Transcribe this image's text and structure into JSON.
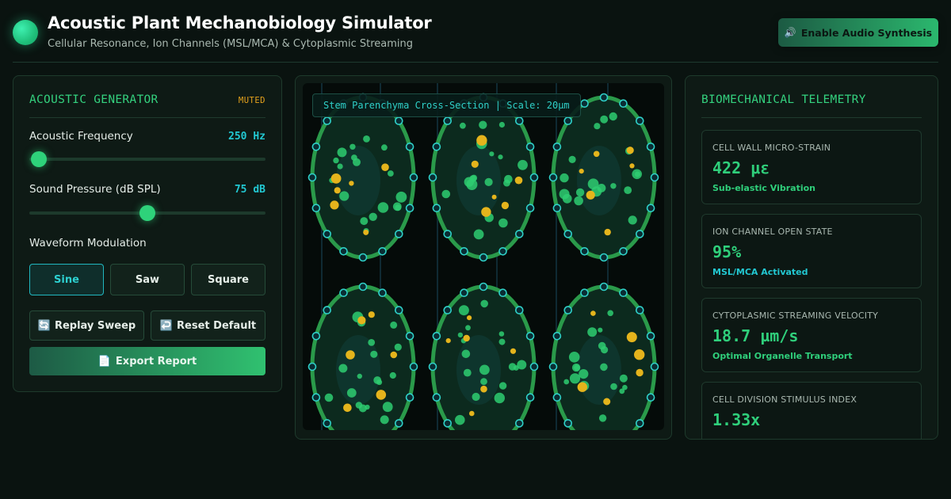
{
  "header": {
    "title": "Acoustic Plant Mechanobiology Simulator",
    "subtitle": "Cellular Resonance, Ion Channels (MSL/MCA) & Cytoplasmic Streaming",
    "audio_button": "Enable Audio Synthesis",
    "audio_icon": "🔊"
  },
  "generator": {
    "title": "ACOUSTIC GENERATOR",
    "status": "MUTED",
    "frequency_label": "Acoustic Frequency",
    "frequency_value": "250 Hz",
    "frequency_level": 0.04,
    "pressure_label": "Sound Pressure (dB SPL)",
    "pressure_value": "75 dB",
    "pressure_level": 0.5,
    "waveform_label": "Waveform Modulation",
    "waveforms": [
      "Sine",
      "Saw",
      "Square"
    ],
    "selected_waveform": "Sine",
    "replay_label": "Replay Sweep",
    "replay_icon": "🔄",
    "reset_label": "Reset Default",
    "reset_icon": "↩️",
    "export_label": "Export Report",
    "export_icon": "📄"
  },
  "visualization": {
    "label": "Stem Parenchyma Cross-Section | Scale: 20µm",
    "colors": {
      "cell_wall": "#2a9a4a",
      "node": "#2fd0c8",
      "chloroplast": "#2ecc71",
      "amyloplast": "#e5b41c",
      "background": "#050b09"
    }
  },
  "telemetry": {
    "title": "BIOMECHANICAL TELEMETRY",
    "cards": [
      {
        "label": "CELL WALL MICRO-STRAIN",
        "value": "422 με",
        "note": "Sub-elastic Vibration",
        "note_color": "#2fcf7b"
      },
      {
        "label": "ION CHANNEL OPEN STATE",
        "value": "95%",
        "note": "MSL/MCA Activated",
        "note_color": "#22c8d2"
      },
      {
        "label": "CYTOPLASMIC STREAMING VELOCITY",
        "value": "18.7 µm/s",
        "note": "Optimal Organelle Transport",
        "note_color": "#2fcf7b"
      },
      {
        "label": "CELL DIVISION STIMULUS INDEX",
        "value": "1.33x",
        "note": "",
        "note_color": "#2fcf7b"
      }
    ]
  }
}
